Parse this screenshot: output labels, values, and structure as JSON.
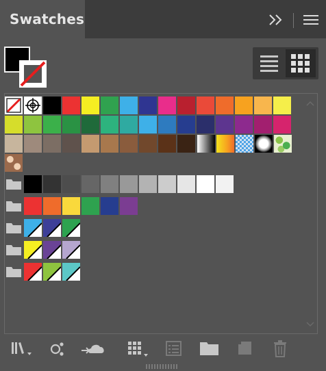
{
  "panel": {
    "title": "Swatches",
    "colors": {
      "bg": "#535353",
      "header": "#3c3c3c"
    }
  },
  "row1": [
    "#ec3232",
    "#f5ee22",
    "#30a24f",
    "#3eb0e8",
    "#2f3591",
    "#e92d8b",
    "#b9202f",
    "#ea4a39",
    "#ef6c2b",
    "#f7a21f",
    "#f8b64d",
    "#f5ee4a"
  ],
  "row2": [
    "#d6dd2b",
    "#8ec43f",
    "#3bb04a",
    "#2a9244",
    "#1f6a3a",
    "#2db37e",
    "#2faaa1",
    "#3eb0e8",
    "#2e7bbf",
    "#263d8f",
    "#2b2f6b",
    "#5d358f",
    "#8d2a8e",
    "#a21f6f",
    "#d6246d"
  ],
  "row3": [
    "#c7b59d",
    "#9e8a7c",
    "#7c6e64",
    "#5f524c",
    "#c49a70",
    "#a8784d",
    "#8a5c3d",
    "#71482c",
    "#5b3218",
    "#3a2314"
  ],
  "grays": [
    "#000000",
    "#333333",
    "#4d4d4d",
    "#666666",
    "#808080",
    "#999999",
    "#b3b3b3",
    "#cccccc",
    "#e6e6e6",
    "#ffffff",
    "#f2f2f2"
  ],
  "group2": [
    "#ec3232",
    "#ef6c2b",
    "#f9d93c",
    "#2ea24f",
    "#263d8f",
    "#7b3d92"
  ],
  "group3": [
    "#3eb0e8",
    "#3d3f98",
    "#2da24f"
  ],
  "group4": [
    "#f5ee22",
    "#6a4396",
    "#b5a6cf"
  ],
  "group5": [
    "#ec3232",
    "#8ec43f",
    "#5cc7c6"
  ]
}
